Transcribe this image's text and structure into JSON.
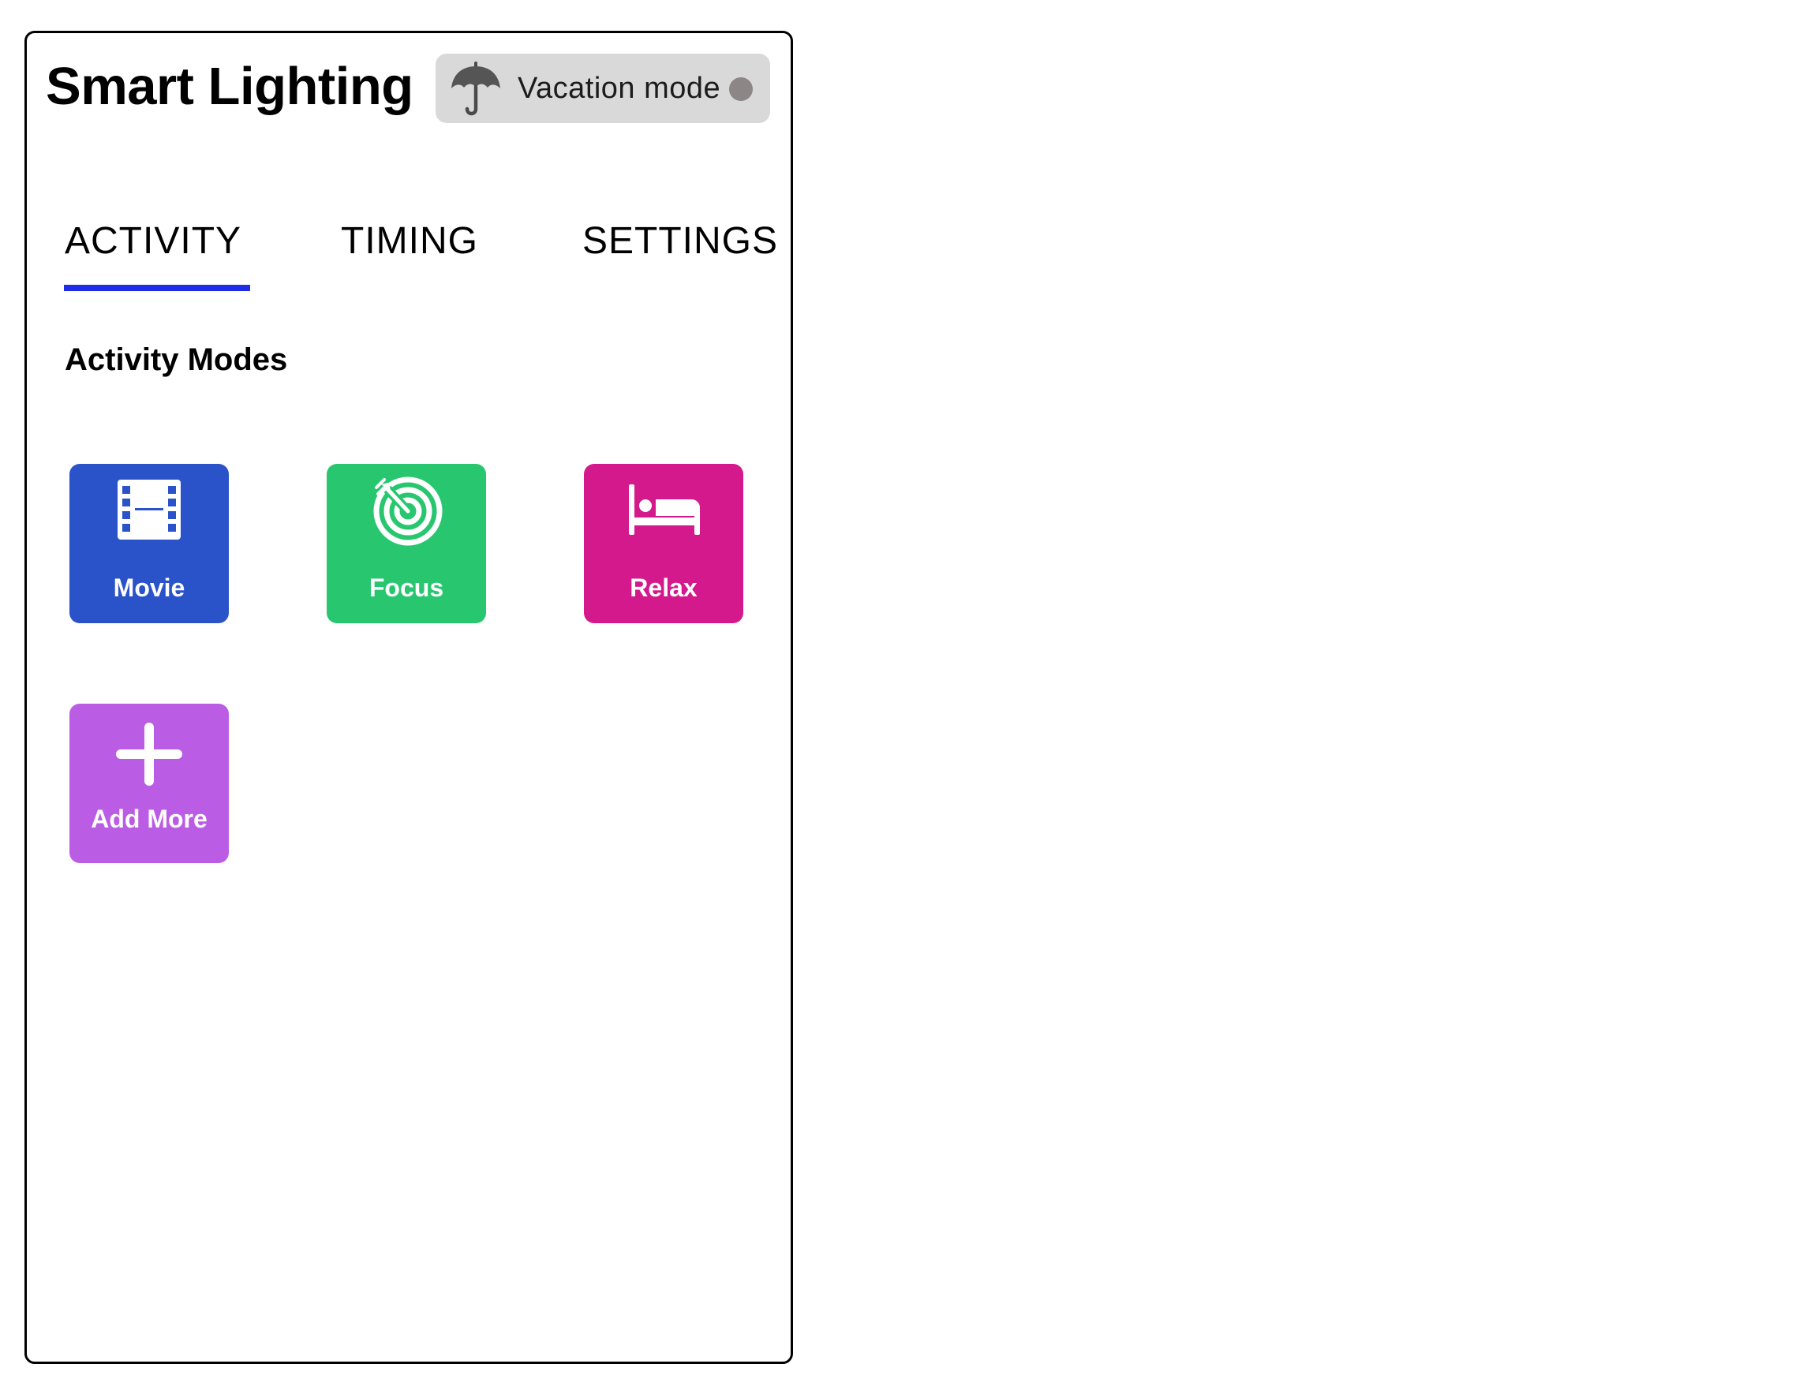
{
  "app": {
    "title": "Smart Lighting"
  },
  "vacation_mode": {
    "label": "Vacation mode",
    "icon": "umbrella-icon",
    "enabled": false,
    "indicator_color": "#8c8686",
    "background_color": "#d9d9d9"
  },
  "tabs": [
    {
      "label": "ACTIVITY",
      "active": true
    },
    {
      "label": "TIMING",
      "active": false
    },
    {
      "label": "SETTINGS",
      "active": false
    }
  ],
  "active_tab_color": "#1f2ee6",
  "section": {
    "heading": "Activity Modes"
  },
  "modes": [
    {
      "label": "Movie",
      "icon": "film-icon",
      "color": "#2a52c9"
    },
    {
      "label": "Focus",
      "icon": "target-icon",
      "color": "#28c76f"
    },
    {
      "label": "Relax",
      "icon": "bed-icon",
      "color": "#d4198c"
    },
    {
      "label": "Add More",
      "icon": "plus-icon",
      "color": "#bb5de4"
    }
  ]
}
